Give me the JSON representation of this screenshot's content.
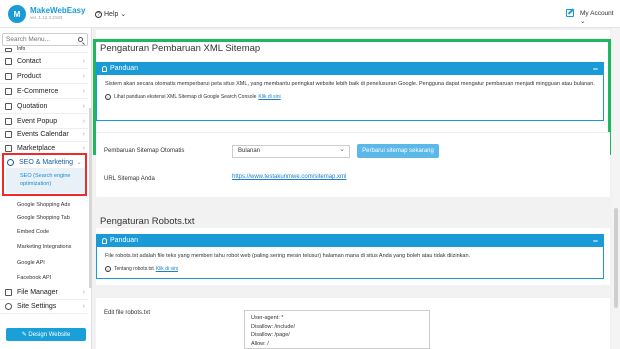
{
  "header": {
    "logo_mark": "M",
    "app_name": "MakeWebEasy",
    "version": "ver. 1.12.3.2183",
    "help_label": "Help",
    "help_chevron": "⌄",
    "account_label": "My Account",
    "account_chevron": "⌄"
  },
  "sidebar": {
    "search_placeholder": "Search Menu...",
    "partial_item": "Info",
    "items": [
      {
        "label": "Contact",
        "icon": "mail-icon"
      },
      {
        "label": "Product",
        "icon": "bag-icon"
      },
      {
        "label": "E-Commerce",
        "icon": "tag-icon"
      },
      {
        "label": "Quotation",
        "icon": "document-icon"
      },
      {
        "label": "Event Popup",
        "icon": "megaphone-icon"
      },
      {
        "label": "Events Calendar",
        "icon": "calendar-icon"
      },
      {
        "label": "Marketplace",
        "icon": "store-icon"
      }
    ],
    "active_section": {
      "label": "SEO & Marketing",
      "icon": "search-icon",
      "chevron": "⌄"
    },
    "active_sub": "SEO (Search engine optimization)",
    "sub_items": [
      "Google Shopping Ads",
      "Google Shopping Tab",
      "Embed Code",
      "Marketing Integrations",
      "Google API",
      "Facebook API"
    ],
    "bottom_items": [
      {
        "label": "File Manager",
        "icon": "folder-icon"
      },
      {
        "label": "Site Settings",
        "icon": "gear-icon"
      }
    ],
    "chevron": "›",
    "design_button": "✎ Design Website"
  },
  "sitemap": {
    "title": "Pengaturan Pembaruan XML Sitemap",
    "guide_title": "Panduan",
    "guide_minus": "−",
    "guide_text": "Sistem akan secara otomatis memperbarui peta situs XML, yang membantu peringkat website lebih baik di penelusuran Google. Pengguna dapat mengatur pembaruan menjadi mingguan atau bulanan.",
    "info_icon": "i",
    "info_text": "Lihat panduan ekstensi XML Sitemap di Google Search Console Klik di sini",
    "info_link": "Klik di sini",
    "auto_update_label": "Pembaruan Sitemap Otomatis",
    "frequency_value": "Bulanan",
    "refresh_button": "Perbarui sitemap sekarang",
    "url_label": "URL Sitemap Anda",
    "url_value": "https://www.testakunmwe.com/sitemap.xml"
  },
  "robots": {
    "title": "Pengaturan Robots.txt",
    "guide_title": "Panduan",
    "guide_minus": "−",
    "guide_text": "File robots.txt adalah file teks yang memberi tahu robot web (paling sering mesin telusur) halaman mana di situs Anda yang boleh atau tidak diizinkan.",
    "info_icon": "i",
    "info_text": "Tentang robots.txt Klik di sini",
    "info_link": "Klik di sini",
    "edit_label": "Edit file robots.txt",
    "content": "User-agent: *\nDisallow: /include/\nDisallow: /page/\nAllow: /"
  }
}
